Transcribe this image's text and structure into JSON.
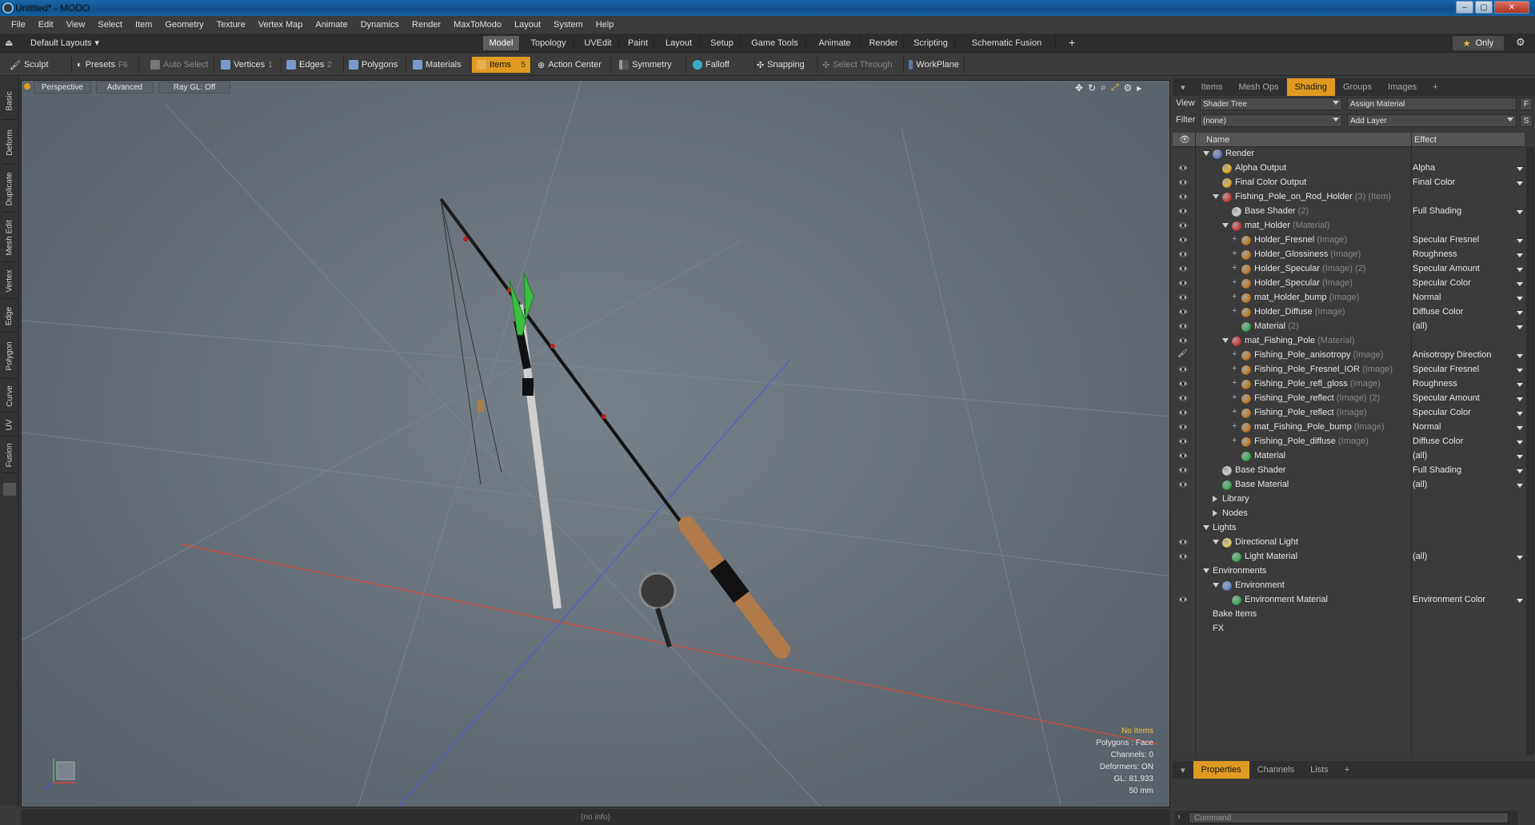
{
  "window": {
    "title": "Untitled* - MODO"
  },
  "menu": [
    "File",
    "Edit",
    "View",
    "Select",
    "Item",
    "Geometry",
    "Texture",
    "Vertex Map",
    "Animate",
    "Dynamics",
    "Render",
    "MaxToModo",
    "Layout",
    "System",
    "Help"
  ],
  "layout_selector": "Default Layouts",
  "layout_tabs": [
    "Model",
    "Topology",
    "UVEdit",
    "Paint",
    "Layout",
    "Setup",
    "Game Tools",
    "Animate",
    "Render",
    "Scripting",
    "Schematic Fusion"
  ],
  "layout_active": "Model",
  "only_label": "Only",
  "toolbar": {
    "sculpt": "Sculpt",
    "presets": "Presets",
    "presets_key": "F6",
    "auto_select": "Auto Select",
    "vertices": "Vertices",
    "vertices_key": "1",
    "edges": "Edges",
    "edges_key": "2",
    "polygons": "Polygons",
    "materials": "Materials",
    "items": "Items",
    "items_key": "5",
    "action_center": "Action Center",
    "symmetry": "Symmetry",
    "falloff": "Falloff",
    "snapping": "Snapping",
    "select_through": "Select Through",
    "workplane": "WorkPlane"
  },
  "left_tabs": [
    "Basic",
    "Deform",
    "Duplicate",
    "Mesh Edit",
    "Vertex",
    "Edge",
    "Polygon",
    "Curve",
    "UV",
    "Fusion"
  ],
  "viewport": {
    "view": "Perspective",
    "shading": "Advanced",
    "raygl": "Ray GL: Off",
    "info": {
      "items": "No Items",
      "polygons": "Polygons : Face",
      "channels": "Channels: 0",
      "deformers": "Deformers: ON",
      "gl": "GL: 81,933",
      "focal": "50 mm"
    }
  },
  "status": "(no info)",
  "right_tabs": [
    "Items",
    "Mesh Ops",
    "Shading",
    "Groups",
    "Images"
  ],
  "right_active": "Shading",
  "shader": {
    "view_label": "View",
    "view_value": "Shader Tree",
    "assign_material": "Assign Material",
    "filter_label": "Filter",
    "filter_value": "(none)",
    "add_layer": "Add Layer",
    "col_name": "Name",
    "col_effect": "Effect",
    "f_btn": "F",
    "s_btn": "S"
  },
  "tree": [
    {
      "name": "Render",
      "sub": "",
      "effect": "",
      "color": "#6a7fd0"
    },
    {
      "name": "Alpha Output",
      "sub": "",
      "effect": "Alpha",
      "color": "#e0b030"
    },
    {
      "name": "Final Color Output",
      "sub": "",
      "effect": "Final Color",
      "color": "#e0b030"
    },
    {
      "name": "Fishing_Pole_on_Rod_Holder",
      "sub": "(3) (Item)",
      "effect": "",
      "color": "#d04040"
    },
    {
      "name": "Base Shader",
      "sub": "(2)",
      "effect": "Full Shading",
      "color": "#cfcfcf"
    },
    {
      "name": "mat_Holder",
      "sub": "(Material)",
      "effect": "",
      "color": "#d04040"
    },
    {
      "name": "Holder_Fresnel",
      "sub": "(Image)",
      "effect": "Specular Fresnel",
      "color": "#c08030"
    },
    {
      "name": "Holder_Glossiness",
      "sub": "(Image)",
      "effect": "Roughness",
      "color": "#c08030"
    },
    {
      "name": "Holder_Specular",
      "sub": "(Image) (2)",
      "effect": "Specular Amount",
      "color": "#c08030"
    },
    {
      "name": "Holder_Specular",
      "sub": "(Image)",
      "effect": "Specular Color",
      "color": "#c08030"
    },
    {
      "name": "mat_Holder_bump",
      "sub": "(Image)",
      "effect": "Normal",
      "color": "#c08030"
    },
    {
      "name": "Holder_Diffuse",
      "sub": "(Image)",
      "effect": "Diffuse Color",
      "color": "#c08030"
    },
    {
      "name": "Material",
      "sub": "(2)",
      "effect": "(all)",
      "color": "#40b060"
    },
    {
      "name": "mat_Fishing_Pole",
      "sub": "(Material)",
      "effect": "",
      "color": "#d04040"
    },
    {
      "name": "Fishing_Pole_anisotropy",
      "sub": "(Image)",
      "effect": "Anisotropy Direction",
      "color": "#c08030"
    },
    {
      "name": "Fishing_Pole_Fresnel_IOR",
      "sub": "(Image)",
      "effect": "Specular Fresnel",
      "color": "#c08030"
    },
    {
      "name": "Fishing_Pole_refl_gloss",
      "sub": "(Image)",
      "effect": "Roughness",
      "color": "#c08030"
    },
    {
      "name": "Fishing_Pole_reflect",
      "sub": "(Image) (2)",
      "effect": "Specular Amount",
      "color": "#c08030"
    },
    {
      "name": "Fishing_Pole_reflect",
      "sub": "(Image)",
      "effect": "Specular Color",
      "color": "#c08030"
    },
    {
      "name": "mat_Fishing_Pole_bump",
      "sub": "(Image)",
      "effect": "Normal",
      "color": "#c08030"
    },
    {
      "name": "Fishing_Pole_diffuse",
      "sub": "(Image)",
      "effect": "Diffuse Color",
      "color": "#c08030"
    },
    {
      "name": "Material",
      "sub": "",
      "effect": "(all)",
      "color": "#40b060"
    },
    {
      "name": "Base Shader",
      "sub": "",
      "effect": "Full Shading",
      "color": "#cfcfcf"
    },
    {
      "name": "Base Material",
      "sub": "",
      "effect": "(all)",
      "color": "#40b060"
    },
    {
      "name": "Library",
      "sub": "",
      "effect": "",
      "color": ""
    },
    {
      "name": "Nodes",
      "sub": "",
      "effect": "",
      "color": ""
    },
    {
      "name": "Lights",
      "sub": "",
      "effect": "",
      "color": ""
    },
    {
      "name": "Directional Light",
      "sub": "",
      "effect": "",
      "color": "#e0d070"
    },
    {
      "name": "Light Material",
      "sub": "",
      "effect": "(all)",
      "color": "#40b060"
    },
    {
      "name": "Environments",
      "sub": "",
      "effect": "",
      "color": ""
    },
    {
      "name": "Environment",
      "sub": "",
      "effect": "",
      "color": "#6a8fd0"
    },
    {
      "name": "Environment Material",
      "sub": "",
      "effect": "Environment Color",
      "color": "#40b060"
    },
    {
      "name": "Bake Items",
      "sub": "",
      "effect": "",
      "color": ""
    },
    {
      "name": "FX",
      "sub": "",
      "effect": "",
      "color": ""
    }
  ],
  "bottom_tabs": [
    "Properties",
    "Channels",
    "Lists"
  ],
  "bottom_active": "Properties",
  "command_placeholder": "Command",
  "colors": {
    "accent": "#e09a22",
    "viewport": "#68717a",
    "x_axis": "#d84a3a",
    "z_axis": "#4a5ad8"
  }
}
